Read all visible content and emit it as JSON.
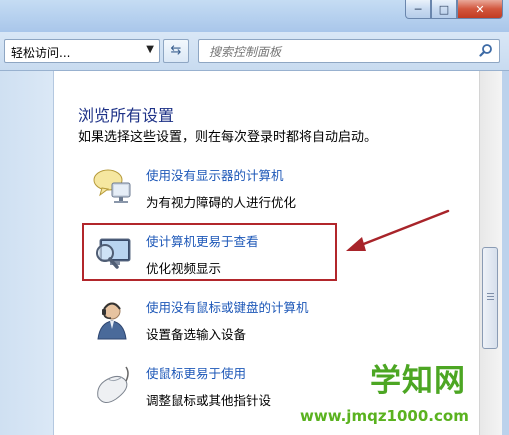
{
  "toolbar": {
    "address_label": "轻松访问...",
    "search_placeholder": "搜索控制面板"
  },
  "main": {
    "heading": "浏览所有设置",
    "subtitle": "如果选择这些设置，则在每次登录时都将自动启动。",
    "items": [
      {
        "icon": "monitor-speech-icon",
        "link": "使用没有显示器的计算机",
        "desc": "为有视力障碍的人进行优化"
      },
      {
        "icon": "magnifier-monitor-icon",
        "link": "使计算机更易于查看",
        "desc": "优化视频显示"
      },
      {
        "icon": "person-headset-icon",
        "link": "使用没有鼠标或键盘的计算机",
        "desc": "设置备选输入设备"
      },
      {
        "icon": "mouse-icon",
        "link": "使鼠标更易于使用",
        "desc": "调整鼠标或其他指针设"
      }
    ]
  },
  "watermark": {
    "title": "学知网",
    "url": "www.jmqz1000.com"
  },
  "colors": {
    "link": "#1e58b8",
    "heading": "#1e3287",
    "highlight": "#b2262b",
    "watermark": "#4ca623"
  }
}
